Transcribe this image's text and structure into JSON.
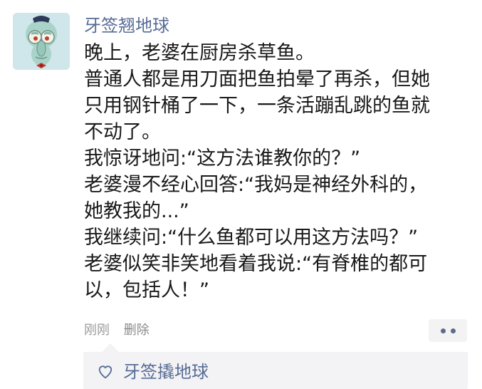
{
  "post": {
    "author": "牙签翘地球",
    "paragraphs": [
      "晚上，老婆在厨房杀草鱼。",
      "普通人都是用刀面把鱼拍晕了再杀，但她\n只用钢针桶了一下，一条活蹦乱跳的鱼就\n不动了。",
      "我惊讶地问:“这方法谁教你的？”",
      "老婆漫不经心回答:“我妈是神经外科的，\n她教我的...”",
      "我继续问:“什么鱼都可以用这方法吗？”",
      "老婆似笑非笑地看着我说:“有脊椎的都可\n以，包括人！”"
    ],
    "time": "刚刚",
    "delete_label": "删除"
  },
  "likes": {
    "icon": "heart-outline-icon",
    "names": "牙签撬地球"
  },
  "colors": {
    "name_blue": "#576b95",
    "text": "#191919",
    "meta_gray": "#9a9a9a",
    "box_bg": "#f3f3f5"
  }
}
